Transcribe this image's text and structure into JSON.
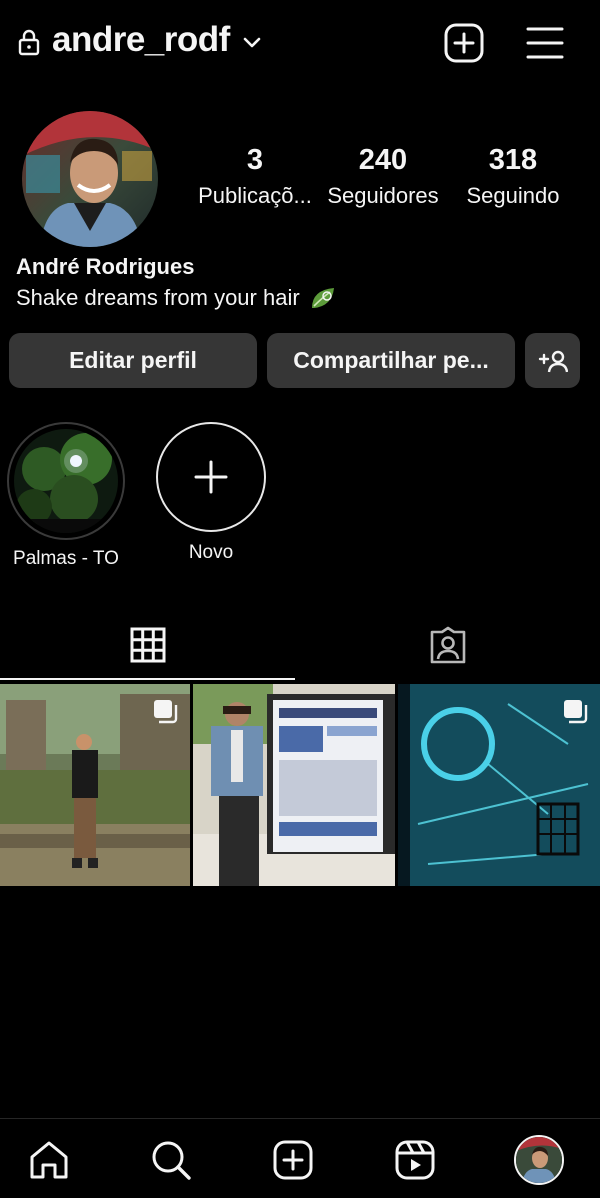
{
  "header": {
    "username": "andre_rodf"
  },
  "profile": {
    "full_name": "André Rodrigues",
    "bio": "Shake dreams from your hair",
    "stats": [
      {
        "value": "3",
        "label": "Publicaçõ..."
      },
      {
        "value": "240",
        "label": "Seguidores"
      },
      {
        "value": "318",
        "label": "Seguindo"
      }
    ]
  },
  "actions": {
    "edit_profile": "Editar perfil",
    "share_profile": "Compartilhar pe..."
  },
  "highlights": [
    {
      "label": "Palmas - TO"
    },
    {
      "label": "Novo"
    }
  ],
  "tabs": [
    {
      "icon": "grid-icon"
    },
    {
      "icon": "tagged-icon"
    }
  ],
  "posts": [
    {
      "multi": true
    },
    {
      "multi": false
    },
    {
      "multi": true
    }
  ],
  "bottom_nav": [
    "home-icon",
    "search-icon",
    "create-icon",
    "reels-icon",
    "profile-avatar"
  ]
}
